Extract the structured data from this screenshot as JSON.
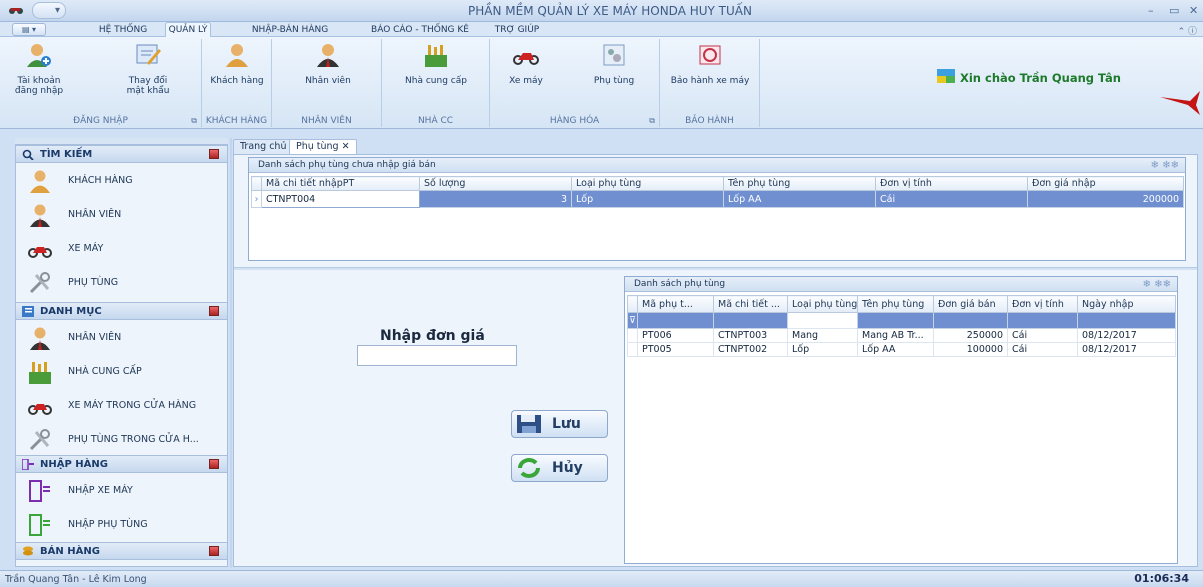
{
  "window": {
    "title": "PHẦN MỀM QUẢN LÝ XE MÁY HONDA HUY TUẤN",
    "controls": [
      "–",
      "▭",
      "✕"
    ]
  },
  "menu": {
    "tabs": [
      "HỆ THỐNG",
      "QUẢN LÝ",
      "NHẬP-BÁN HÀNG",
      "BÁO CÁO - THỐNG KÊ",
      "TRỢ GIÚP"
    ],
    "right": "⌃ ⓘ"
  },
  "ribbon": {
    "groups": [
      {
        "label": "ĐĂNG NHẬP",
        "buttons": [
          "Tài khoản\nđăng nhập",
          "Thay đổi\nmật khẩu"
        ]
      },
      {
        "label": "KHÁCH HÀNG",
        "buttons": [
          "Khách hàng"
        ]
      },
      {
        "label": "NHÂN VIÊN",
        "buttons": [
          "Nhân viên"
        ]
      },
      {
        "label": "NHÀ CC",
        "buttons": [
          "Nhà cung cấp"
        ]
      },
      {
        "label": "HÀNG HÓA",
        "buttons": [
          "Xe máy",
          "Phụ tùng"
        ]
      },
      {
        "label": "BẢO HÀNH",
        "buttons": [
          "Bảo hành xe máy"
        ]
      }
    ],
    "greeting": "Xin chào Trần Quang Tân"
  },
  "sidebar": {
    "sections": [
      {
        "title": "TÌM KIẾM",
        "items": [
          "KHÁCH HÀNG",
          "NHÂN VIÊN",
          "XE MÁY",
          "PHỤ TÙNG"
        ]
      },
      {
        "title": "DANH MỤC",
        "items": [
          "NHÂN VIÊN",
          "NHÀ CUNG CẤP",
          "XE MÁY TRONG CỬA HÀNG",
          "PHỤ TÙNG TRONG CỬA H..."
        ]
      },
      {
        "title": "NHẬP HÀNG",
        "items": [
          "NHẬP XE MÁY",
          "NHẬP PHỤ TÙNG"
        ]
      },
      {
        "title": "BÁN HÀNG",
        "items": []
      }
    ]
  },
  "doc_tabs": [
    "Trang chủ",
    "Phụ tùng  ✕"
  ],
  "grid1": {
    "title": "Danh sách phụ tùng chưa nhập giá bán",
    "columns": [
      "Mã chi tiết nhậpPT",
      "Số lượng",
      "Loại phụ tùng",
      "Tên phụ tùng",
      "Đơn vị tính",
      "Đơn giá nhập"
    ],
    "rows": [
      [
        "CTNPT004",
        "3",
        "Lốp",
        "Lốp AA",
        "Cái",
        "200000"
      ]
    ]
  },
  "form": {
    "title": "Nhập đơn giá",
    "input_value": "",
    "save": "Lưu",
    "cancel": "Hủy"
  },
  "grid2": {
    "title": "Danh sách phụ tùng",
    "columns": [
      "Mã phụ t...",
      "Mã chi tiết ...",
      "Loại phụ tùng",
      "Tên phụ tùng",
      "Đơn giá bán",
      "Đơn vị tính",
      "Ngày nhập"
    ],
    "rows": [
      [
        "PT006",
        "CTNPT003",
        "Mang",
        "Mang AB Tr...",
        "250000",
        "Cái",
        "08/12/2017"
      ],
      [
        "PT005",
        "CTNPT002",
        "Lốp",
        "Lốp AA",
        "100000",
        "Cái",
        "08/12/2017"
      ]
    ]
  },
  "status": {
    "left": "Trần Quang Tân - Lê Kim Long",
    "time": "01:06:34"
  },
  "colors": {
    "accent": "#6f8fd1",
    "greeting": "#1c7a2a"
  }
}
